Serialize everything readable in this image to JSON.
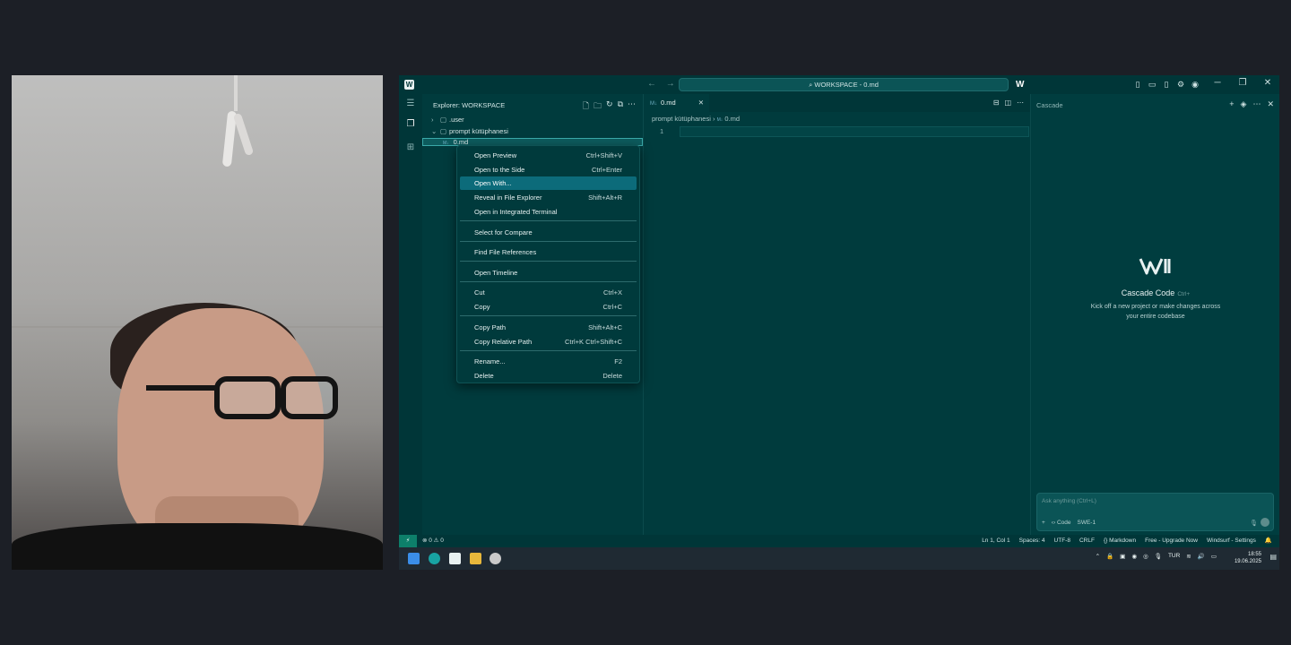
{
  "titlebar": {
    "search_text": "WORKSPACE - 0.md",
    "back_arrow": "←",
    "forward_arrow": "→"
  },
  "sidebar": {
    "header": "Explorer: WORKSPACE",
    "items": [
      {
        "label": ".user",
        "type": "folder",
        "expanded": false
      },
      {
        "label": "prompt kütüphanesi",
        "type": "folder",
        "expanded": true
      },
      {
        "label": "0.md",
        "type": "file",
        "selected": true
      }
    ]
  },
  "editor": {
    "tab_label": "0.md",
    "tab_badge": "M↓",
    "breadcrumb_folder": "prompt kütüphanesi",
    "breadcrumb_sep": "›",
    "breadcrumb_file": "0.md",
    "line_number": "1"
  },
  "context_menu": {
    "items": [
      {
        "label": "Open Preview",
        "shortcut": "Ctrl+Shift+V"
      },
      {
        "label": "Open to the Side",
        "shortcut": "Ctrl+Enter"
      },
      {
        "label": "Open With...",
        "shortcut": "",
        "highlighted": true
      },
      {
        "label": "Reveal in File Explorer",
        "shortcut": "Shift+Alt+R"
      },
      {
        "label": "Open in Integrated Terminal",
        "shortcut": ""
      },
      {
        "label": "Select for Compare",
        "shortcut": ""
      },
      {
        "label": "Find File References",
        "shortcut": ""
      },
      {
        "label": "Open Timeline",
        "shortcut": ""
      },
      {
        "label": "Cut",
        "shortcut": "Ctrl+X"
      },
      {
        "label": "Copy",
        "shortcut": "Ctrl+C"
      },
      {
        "label": "Copy Path",
        "shortcut": "Shift+Alt+C"
      },
      {
        "label": "Copy Relative Path",
        "shortcut": "Ctrl+K Ctrl+Shift+C"
      },
      {
        "label": "Rename...",
        "shortcut": "F2"
      },
      {
        "label": "Delete",
        "shortcut": "Delete"
      }
    ]
  },
  "cascade": {
    "header": "Cascade",
    "title": "Cascade Code",
    "title_shortcut": "Ctrl+",
    "description": "Kick off a new project or make changes across your entire codebase",
    "input_placeholder": "Ask anything (Ctrl+L)",
    "mode_label": "Code",
    "model_label": "SWE-1",
    "add_label": "+"
  },
  "statusbar": {
    "problems": "⊗ 0 ⚠ 0",
    "position": "Ln 1, Col 1",
    "spaces": "Spaces: 4",
    "encoding": "UTF-8",
    "eol": "CRLF",
    "language": "Markdown",
    "plan": "Free - Upgrade Now",
    "settings": "Windsurf - Settings"
  },
  "taskbar": {
    "language": "TUR",
    "time": "18:55",
    "date": "19.06.2025"
  },
  "colors": {
    "accent": "#0c6b7a",
    "editor_bg": "#003b3d",
    "status_remote": "#0d7f6a"
  }
}
